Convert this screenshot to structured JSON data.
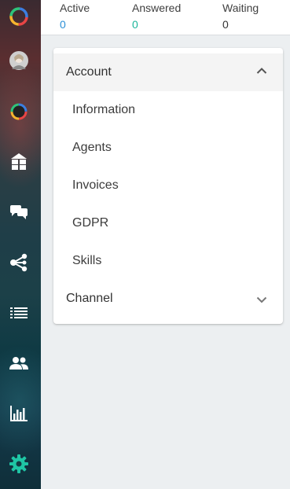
{
  "colors": {
    "active_value": "#2a8fd6",
    "answered_value": "#1bb59a",
    "waiting_value": "#333333",
    "settings_accent": "#1fc6a5"
  },
  "sidebar": {
    "items": [
      {
        "name": "logo",
        "icon": "ring-logo-icon"
      },
      {
        "name": "user-avatar",
        "icon": "avatar"
      },
      {
        "name": "status-ring",
        "icon": "status-ring-icon"
      },
      {
        "name": "dashboard",
        "icon": "dashboard-icon"
      },
      {
        "name": "conversations",
        "icon": "chat-bubbles-icon"
      },
      {
        "name": "integrations",
        "icon": "share-icon"
      },
      {
        "name": "queue",
        "icon": "list-icon"
      },
      {
        "name": "contacts",
        "icon": "people-icon"
      },
      {
        "name": "reports",
        "icon": "bar-chart-icon"
      },
      {
        "name": "settings",
        "icon": "gear-icon",
        "active": true
      }
    ]
  },
  "stats": {
    "active": {
      "label": "Active",
      "value": "0"
    },
    "answered": {
      "label": "Answered",
      "value": "0"
    },
    "waiting": {
      "label": "Waiting",
      "value": "0"
    }
  },
  "settings_menu": {
    "account": {
      "label": "Account",
      "expanded": true,
      "items": [
        "Information",
        "Agents",
        "Invoices",
        "GDPR",
        "Skills"
      ]
    },
    "channel": {
      "label": "Channel",
      "expanded": false
    }
  }
}
